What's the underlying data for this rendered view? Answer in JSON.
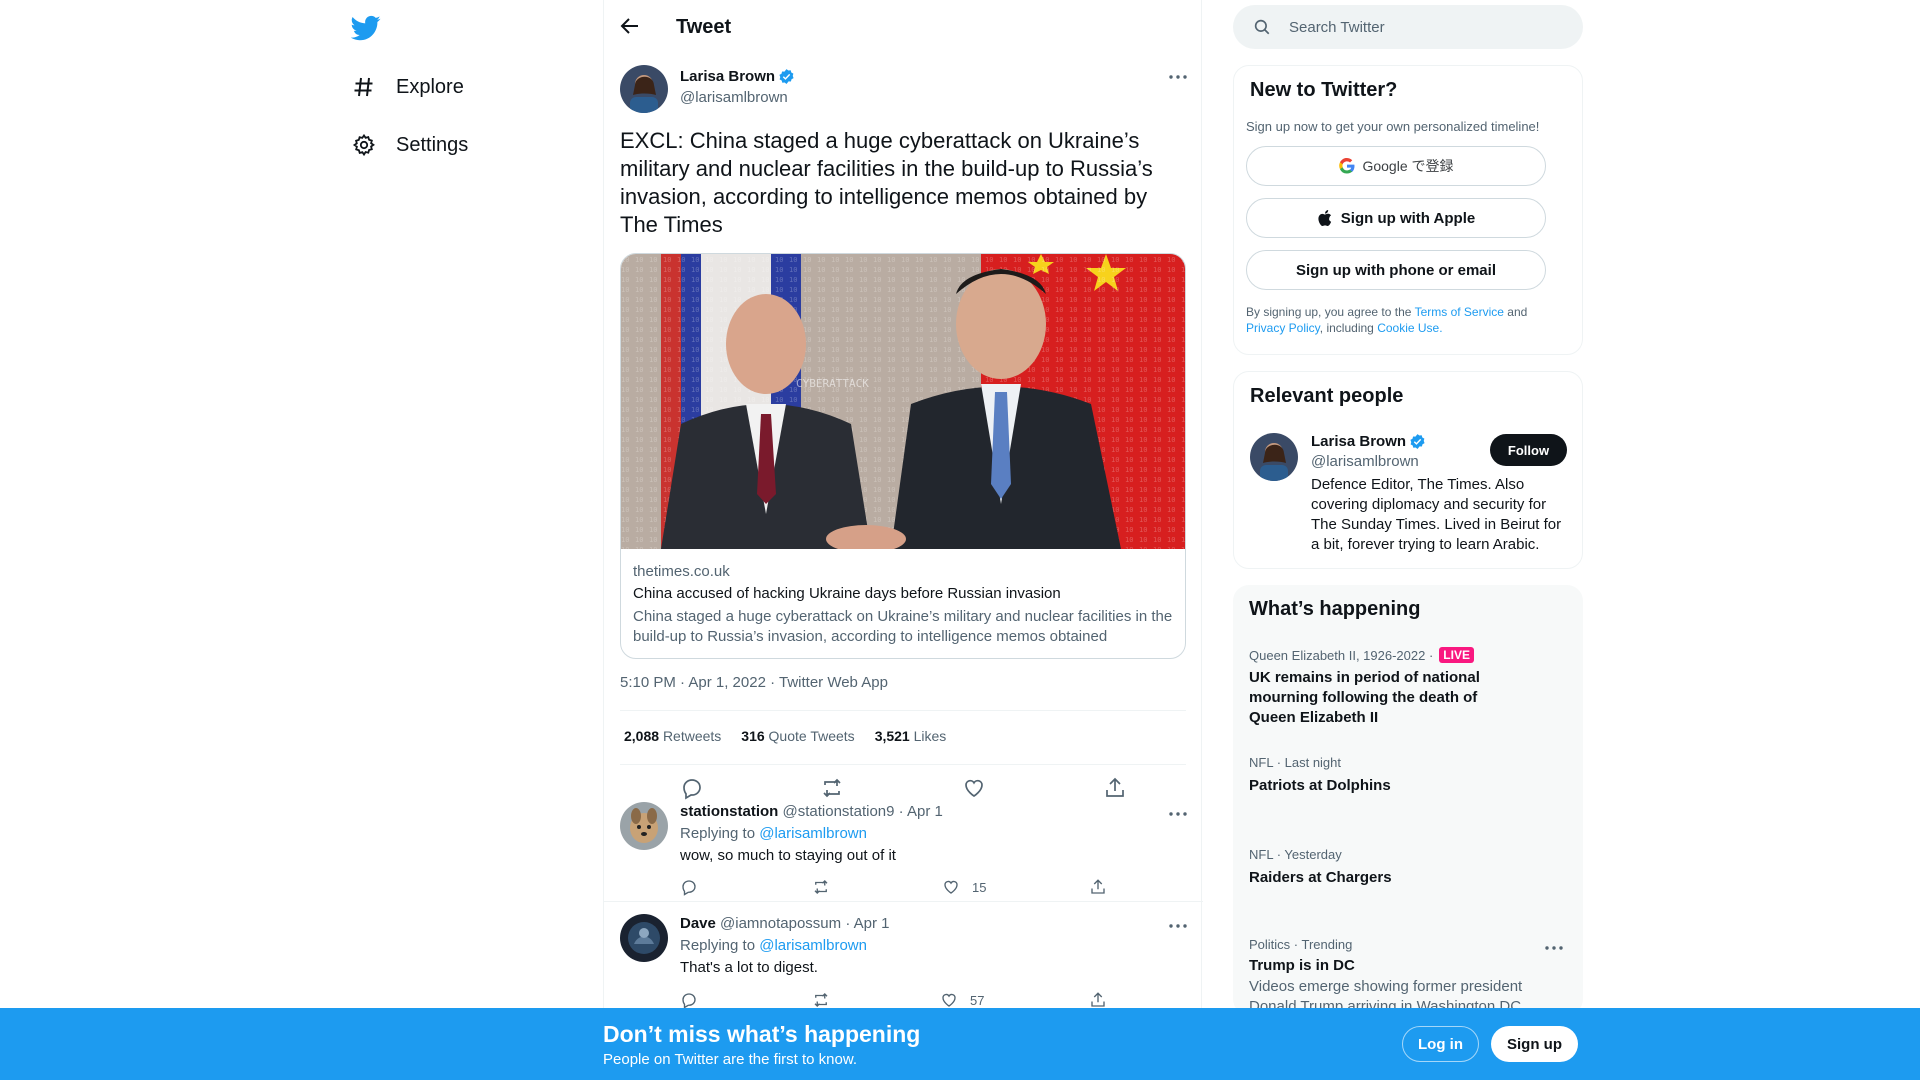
{
  "nav": {
    "logo_icon": "twitter-bird-icon",
    "items": [
      {
        "label": "Explore",
        "icon": "hashtag-icon"
      },
      {
        "label": "Settings",
        "icon": "gear-icon"
      }
    ]
  },
  "header": {
    "title": "Tweet"
  },
  "tweet": {
    "author_name": "Larisa Brown",
    "author_handle": "@larisamlbrown",
    "text": "EXCL: China staged a huge cyberattack on Ukraine’s military and nuclear facilities in the build-up to Russia’s invasion, according to intelligence memos obtained by The Times",
    "card": {
      "image_text": "CYBERATTACK",
      "domain": "thetimes.co.uk",
      "title": "China accused of hacking Ukraine days before Russian invasion",
      "description": "China staged a huge cyberattack on Ukraine’s military and nuclear facilities in the build-up to Russia’s invasion, according to intelligence memos obtained"
    },
    "meta": "5:10 PM · Apr 1, 2022 · Twitter Web App",
    "stats": {
      "retweets_count": "2,088",
      "retweets_label": "Retweets",
      "quotes_count": "316",
      "quotes_label": "Quote Tweets",
      "likes_count": "3,521",
      "likes_label": "Likes"
    }
  },
  "replies": [
    {
      "name": "stationstation",
      "handle": "@stationstation9",
      "date": "· Apr 1",
      "replying_prefix": "Replying to",
      "replying_to": "@larisamlbrown",
      "text": "wow, so much to staying out of it",
      "likes": "15"
    },
    {
      "name": "Dave",
      "handle": "@iamnotapossum",
      "date": "· Apr 1",
      "replying_prefix": "Replying to",
      "replying_to": "@larisamlbrown",
      "text": "That's a lot to digest.",
      "likes": "57"
    }
  ],
  "search": {
    "placeholder": "Search Twitter"
  },
  "new_to_twitter": {
    "title": "New to Twitter?",
    "subtitle": "Sign up now to get your own personalized timeline!",
    "google_label": "Google で登録",
    "apple_label": "Sign up with Apple",
    "phone_label": "Sign up with phone or email",
    "legal_prefix": "By signing up, you agree to the",
    "terms": "Terms of Service",
    "and": "and",
    "privacy": "Privacy Policy",
    "including": ", including",
    "cookie": "Cookie Use."
  },
  "relevant_people": {
    "title": "Relevant people",
    "name": "Larisa Brown",
    "handle": "@larisamlbrown",
    "bio": "Defence Editor, The Times. Also covering diplomacy and security for The Sunday Times. Lived in Beirut for a bit, forever trying to learn Arabic.",
    "follow_label": "Follow"
  },
  "whats_happening": {
    "title": "What’s happening",
    "trends": [
      {
        "context": "Queen Elizabeth II, 1926-2022 ·",
        "badge": "LIVE",
        "title": "UK remains in period of national mourning following the death of Queen Elizabeth II"
      },
      {
        "context": "NFL · Last night",
        "title": "Patriots at Dolphins"
      },
      {
        "context": "NFL · Yesterday",
        "title": "Raiders at Chargers"
      },
      {
        "context": "Politics · Trending",
        "title": "Trump is in DC",
        "description": "Videos emerge showing former president Donald Trump arriving in Washington DC"
      }
    ]
  },
  "bottom_bar": {
    "title": "Don’t miss what’s happening",
    "subtitle": "People on Twitter are the first to know.",
    "login_label": "Log in",
    "signup_label": "Sign up"
  },
  "colors": {
    "brand": "#1d9bf0",
    "live": "#f91880",
    "text": "#0f1419",
    "muted": "#536471"
  }
}
